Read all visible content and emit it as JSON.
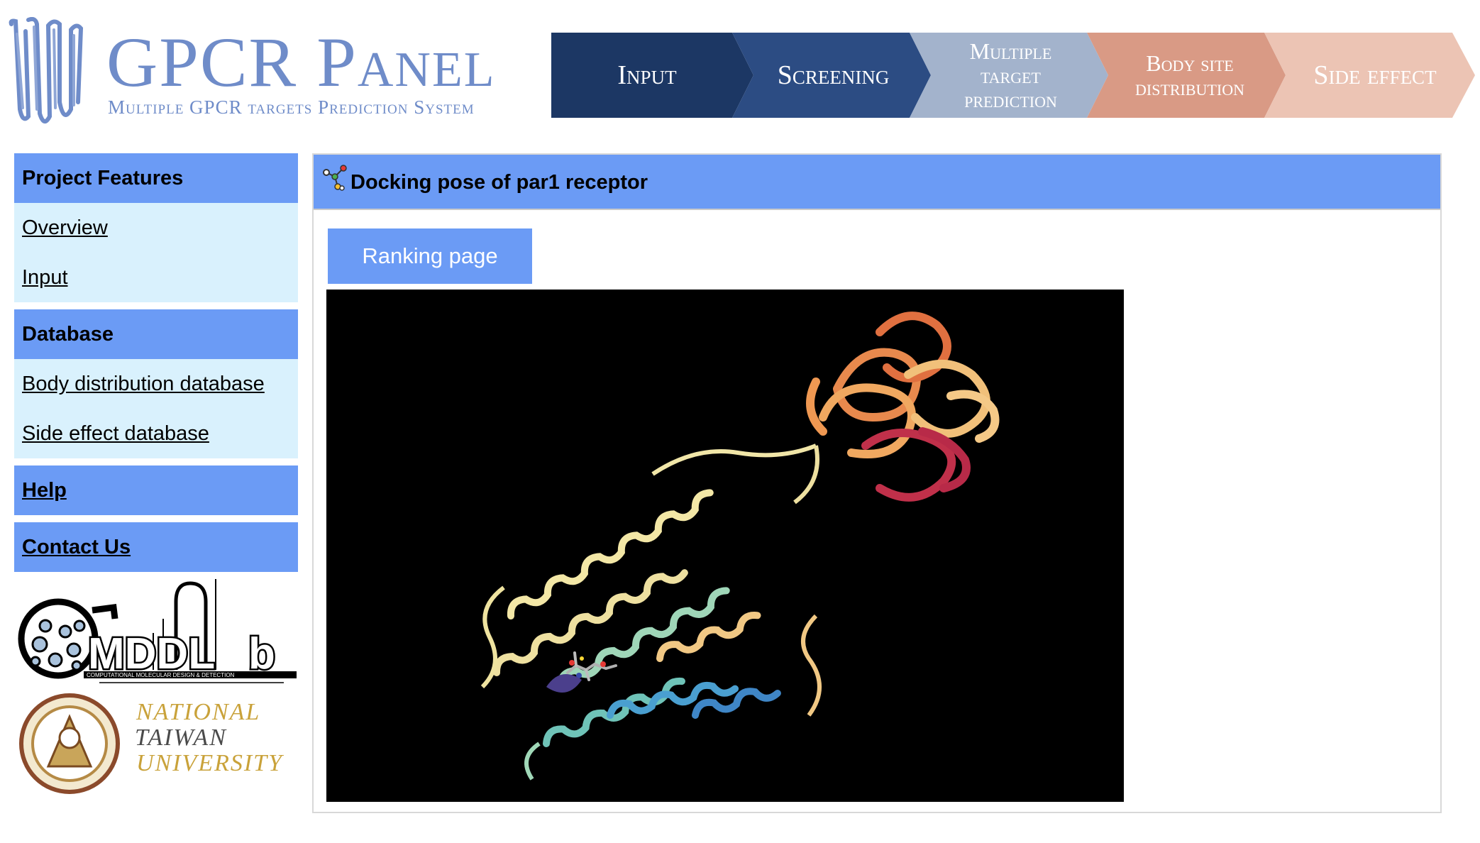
{
  "header": {
    "logo_title": "GPCR Panel",
    "logo_subtitle": "Multiple GPCR targets Prediction System",
    "steps": [
      {
        "label": "Input",
        "color": "#1c3764"
      },
      {
        "label": "Screening",
        "color": "#2c4c83"
      },
      {
        "label": "Multiple\ntarget\nprediction",
        "color": "#a3b3cc"
      },
      {
        "label": "Body site\ndistribution",
        "color": "#d99a85"
      },
      {
        "label": "Side effect",
        "color": "#ecc4b4"
      }
    ]
  },
  "sidebar": {
    "project_features": {
      "heading": "Project Features",
      "links": [
        "Overview",
        "Input"
      ]
    },
    "database": {
      "heading": "Database",
      "links": [
        "Body distribution database",
        "Side effect database"
      ]
    },
    "help": "Help",
    "contact": "Contact Us",
    "mdd_logo": {
      "text": "MDDLab",
      "subtext": "COMPUTATIONAL MOLECULAR DESIGN & DETECTION"
    },
    "ntu_logo": {
      "lines": [
        "NATIONAL",
        "TAIWAN",
        "UNIVERSITY"
      ]
    }
  },
  "main": {
    "title": "Docking pose of par1 receptor",
    "ranking_button": "Ranking page",
    "viewer_background": "#000000"
  },
  "colors": {
    "accent": "#6b9bf5",
    "sidebar_link_bg": "#d9f1fd",
    "logo_blue": "#6f8cc9"
  }
}
